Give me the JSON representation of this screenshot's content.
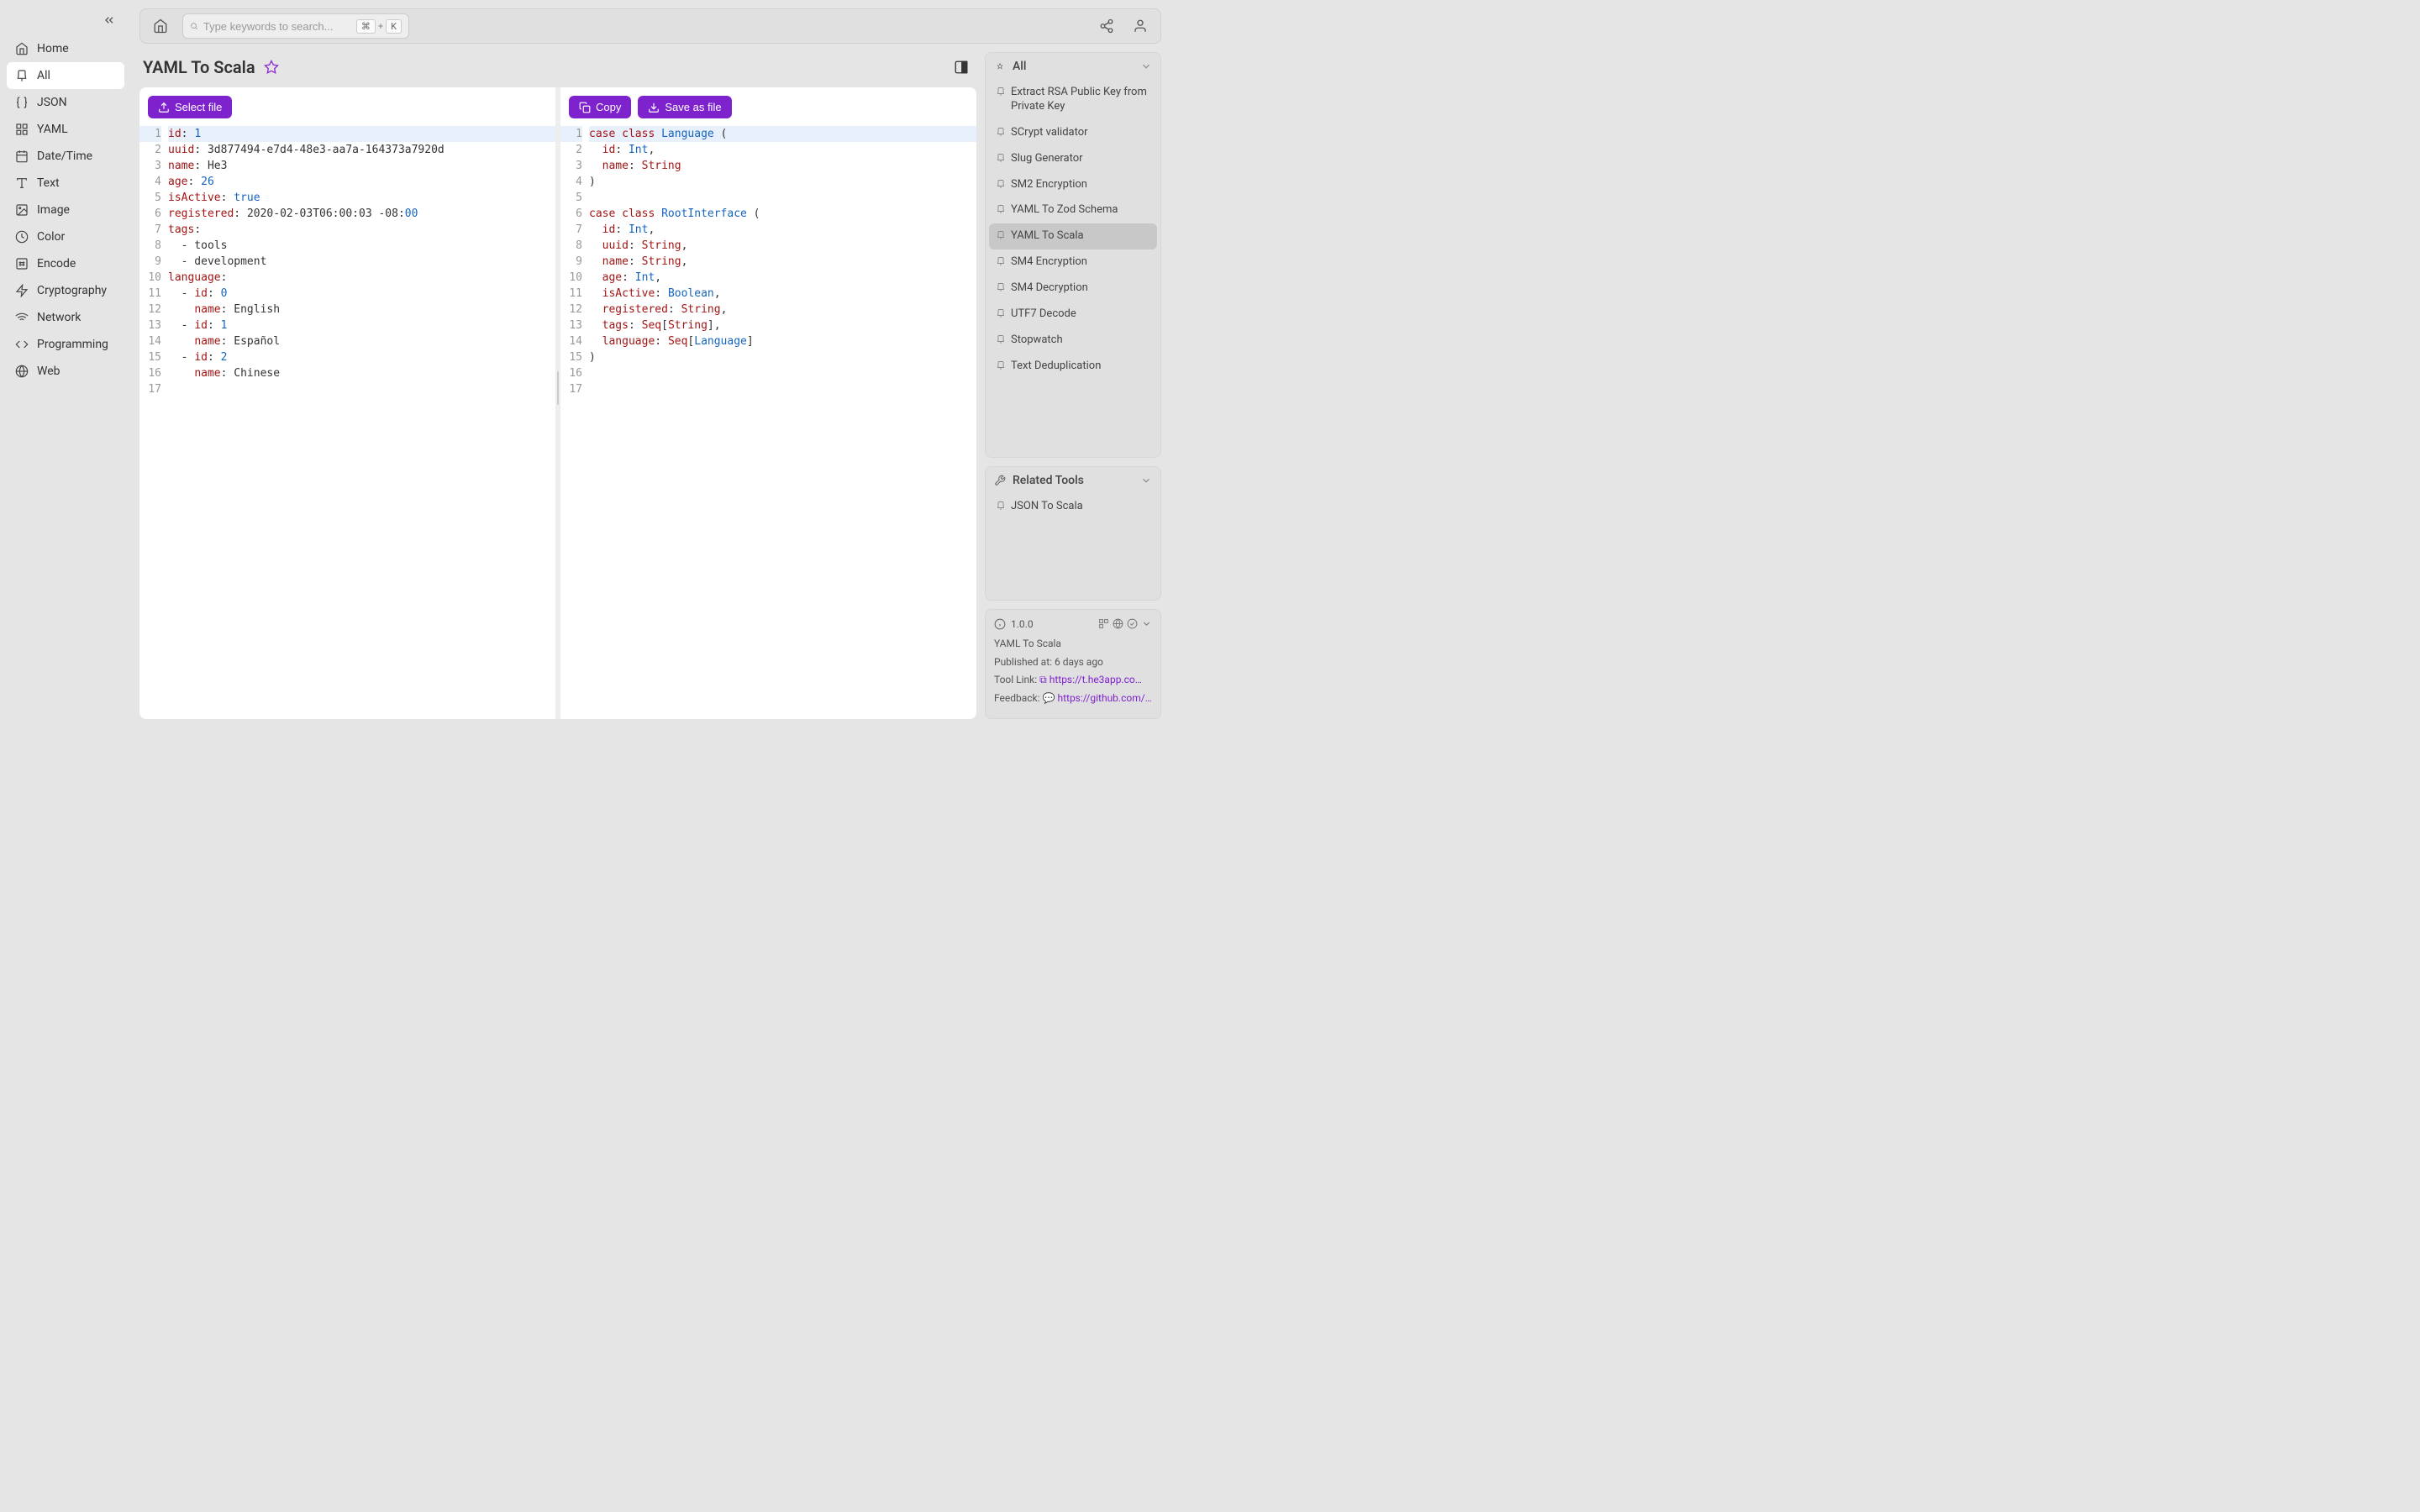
{
  "sidebar": {
    "items": [
      {
        "label": "Home",
        "icon": "home"
      },
      {
        "label": "All",
        "icon": "pin",
        "active": true
      },
      {
        "label": "JSON",
        "icon": "braces"
      },
      {
        "label": "YAML",
        "icon": "grid"
      },
      {
        "label": "Date/Time",
        "icon": "calendar"
      },
      {
        "label": "Text",
        "icon": "text"
      },
      {
        "label": "Image",
        "icon": "image"
      },
      {
        "label": "Color",
        "icon": "palette"
      },
      {
        "label": "Encode",
        "icon": "hash"
      },
      {
        "label": "Cryptography",
        "icon": "bolt"
      },
      {
        "label": "Network",
        "icon": "wifi"
      },
      {
        "label": "Programming",
        "icon": "code"
      },
      {
        "label": "Web",
        "icon": "globe"
      }
    ]
  },
  "topbar": {
    "search_placeholder": "Type keywords to search...",
    "kbd1": "⌘",
    "kbd_plus": "+",
    "kbd2": "K"
  },
  "page": {
    "title": "YAML To Scala"
  },
  "buttons": {
    "select_file": "Select file",
    "copy": "Copy",
    "save_as_file": "Save as file"
  },
  "editor_left": {
    "lines": 17,
    "tokens": [
      [
        [
          "id",
          "key"
        ],
        [
          ": ",
          "punct"
        ],
        [
          "1",
          "num"
        ]
      ],
      [
        [
          "uuid",
          "key"
        ],
        [
          ": ",
          "punct"
        ],
        [
          "3d877494-e7d4-48e3-aa7a-164373a7920d",
          "text"
        ]
      ],
      [
        [
          "name",
          "key"
        ],
        [
          ": ",
          "punct"
        ],
        [
          "He3",
          "text"
        ]
      ],
      [
        [
          "age",
          "key"
        ],
        [
          ": ",
          "punct"
        ],
        [
          "26",
          "num"
        ]
      ],
      [
        [
          "isActive",
          "key"
        ],
        [
          ": ",
          "punct"
        ],
        [
          "true",
          "bool"
        ]
      ],
      [
        [
          "registered",
          "key"
        ],
        [
          ": ",
          "punct"
        ],
        [
          "2020-02-03T06:00:03 -08:",
          "text"
        ],
        [
          "00",
          "num"
        ]
      ],
      [
        [
          "tags",
          "key"
        ],
        [
          ":",
          "punct"
        ]
      ],
      [
        [
          "  - tools",
          "text"
        ]
      ],
      [
        [
          "  - development",
          "text"
        ]
      ],
      [
        [
          "language",
          "key"
        ],
        [
          ":",
          "punct"
        ]
      ],
      [
        [
          "  - ",
          "text"
        ],
        [
          "id",
          "key"
        ],
        [
          ": ",
          "punct"
        ],
        [
          "0",
          "num"
        ]
      ],
      [
        [
          "    ",
          "text"
        ],
        [
          "name",
          "key"
        ],
        [
          ": ",
          "punct"
        ],
        [
          "English",
          "text"
        ]
      ],
      [
        [
          "  - ",
          "text"
        ],
        [
          "id",
          "key"
        ],
        [
          ": ",
          "punct"
        ],
        [
          "1",
          "num"
        ]
      ],
      [
        [
          "    ",
          "text"
        ],
        [
          "name",
          "key"
        ],
        [
          ": ",
          "punct"
        ],
        [
          "Español",
          "text"
        ]
      ],
      [
        [
          "  - ",
          "text"
        ],
        [
          "id",
          "key"
        ],
        [
          ": ",
          "punct"
        ],
        [
          "2",
          "num"
        ]
      ],
      [
        [
          "    ",
          "text"
        ],
        [
          "name",
          "key"
        ],
        [
          ": ",
          "punct"
        ],
        [
          "Chinese",
          "text"
        ]
      ],
      []
    ]
  },
  "editor_right": {
    "lines": 17,
    "tokens": [
      [
        [
          "case",
          "kw"
        ],
        [
          " ",
          "text"
        ],
        [
          "class",
          "kw"
        ],
        [
          " ",
          "text"
        ],
        [
          "Language",
          "type"
        ],
        [
          " (",
          "punct"
        ]
      ],
      [
        [
          "  ",
          "text"
        ],
        [
          "id",
          "key"
        ],
        [
          ": ",
          "punct"
        ],
        [
          "Int",
          "type"
        ],
        [
          ",",
          "punct"
        ]
      ],
      [
        [
          "  ",
          "text"
        ],
        [
          "name",
          "key"
        ],
        [
          ": ",
          "punct"
        ],
        [
          "String",
          "kw"
        ]
      ],
      [
        [
          ")",
          "punct"
        ]
      ],
      [],
      [
        [
          "case",
          "kw"
        ],
        [
          " ",
          "text"
        ],
        [
          "class",
          "kw"
        ],
        [
          " ",
          "text"
        ],
        [
          "RootInterface",
          "type"
        ],
        [
          " (",
          "punct"
        ]
      ],
      [
        [
          "  ",
          "text"
        ],
        [
          "id",
          "key"
        ],
        [
          ": ",
          "punct"
        ],
        [
          "Int",
          "type"
        ],
        [
          ",",
          "punct"
        ]
      ],
      [
        [
          "  ",
          "text"
        ],
        [
          "uuid",
          "key"
        ],
        [
          ": ",
          "punct"
        ],
        [
          "String",
          "kw"
        ],
        [
          ",",
          "punct"
        ]
      ],
      [
        [
          "  ",
          "text"
        ],
        [
          "name",
          "key"
        ],
        [
          ": ",
          "punct"
        ],
        [
          "String",
          "kw"
        ],
        [
          ",",
          "punct"
        ]
      ],
      [
        [
          "  ",
          "text"
        ],
        [
          "age",
          "key"
        ],
        [
          ": ",
          "punct"
        ],
        [
          "Int",
          "type"
        ],
        [
          ",",
          "punct"
        ]
      ],
      [
        [
          "  ",
          "text"
        ],
        [
          "isActive",
          "key"
        ],
        [
          ": ",
          "punct"
        ],
        [
          "Boolean",
          "type"
        ],
        [
          ",",
          "punct"
        ]
      ],
      [
        [
          "  ",
          "text"
        ],
        [
          "registered",
          "key"
        ],
        [
          ": ",
          "punct"
        ],
        [
          "String",
          "kw"
        ],
        [
          ",",
          "punct"
        ]
      ],
      [
        [
          "  ",
          "text"
        ],
        [
          "tags",
          "key"
        ],
        [
          ": ",
          "punct"
        ],
        [
          "Seq",
          "kw"
        ],
        [
          "[",
          "punct"
        ],
        [
          "String",
          "kw"
        ],
        [
          "]",
          "punct"
        ],
        [
          ",",
          "punct"
        ]
      ],
      [
        [
          "  ",
          "text"
        ],
        [
          "language",
          "key"
        ],
        [
          ": ",
          "punct"
        ],
        [
          "Seq",
          "kw"
        ],
        [
          "[",
          "punct"
        ],
        [
          "Language",
          "type"
        ],
        [
          "]",
          "punct"
        ]
      ],
      [
        [
          ")",
          "punct"
        ]
      ],
      [],
      []
    ]
  },
  "rightpanel": {
    "all_header": "All",
    "all_items": [
      {
        "label": "Extract RSA Public Key from Private Key"
      },
      {
        "label": "SCrypt validator"
      },
      {
        "label": "Slug Generator"
      },
      {
        "label": "SM2 Encryption"
      },
      {
        "label": "YAML To Zod Schema"
      },
      {
        "label": "YAML To Scala",
        "active": true
      },
      {
        "label": "SM4 Encryption"
      },
      {
        "label": "SM4 Decryption"
      },
      {
        "label": "UTF7 Decode"
      },
      {
        "label": "Stopwatch"
      },
      {
        "label": "Text Deduplication"
      }
    ],
    "related_header": "Related Tools",
    "related_items": [
      {
        "label": "JSON To Scala"
      }
    ]
  },
  "info": {
    "version": "1.0.0",
    "name": "YAML To Scala",
    "published_label": "Published at:",
    "published_value": "6 days ago",
    "tool_link_label": "Tool Link:",
    "tool_link_value": "https://t.he3app.co…",
    "feedback_label": "Feedback:",
    "feedback_value": "https://github.com/…"
  }
}
